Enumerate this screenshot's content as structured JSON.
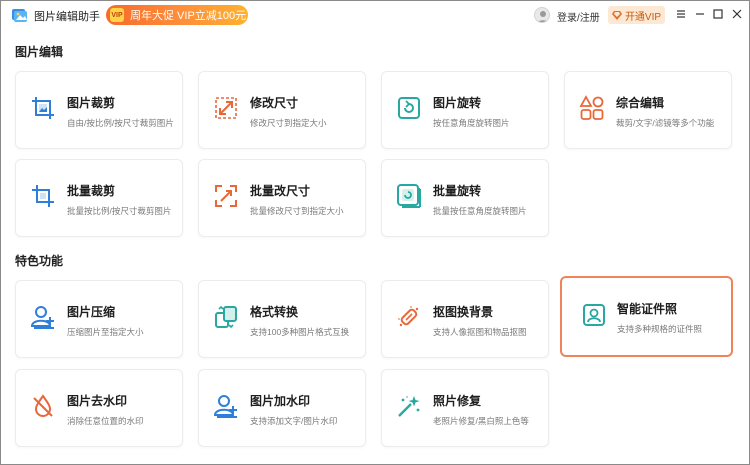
{
  "app": {
    "title": "图片编辑助手",
    "promo_badge": "VIP",
    "promo_text": "周年大促 VIP立减100元",
    "login_text": "登录/注册",
    "vip_button": "开通VIP"
  },
  "colors": {
    "accent_orange": "#e8683a",
    "accent_blue": "#2e7fd9",
    "accent_teal": "#28a8a0",
    "selected_border": "#f0835a"
  },
  "sections": {
    "edit_title": "图片编辑",
    "feature_title": "特色功能"
  },
  "edit_cards": [
    {
      "title": "图片裁剪",
      "desc": "自由/按比例/按尺寸裁剪图片",
      "icon": "crop-image-icon"
    },
    {
      "title": "修改尺寸",
      "desc": "修改尺寸到指定大小",
      "icon": "resize-icon"
    },
    {
      "title": "图片旋转",
      "desc": "按任意角度旋转图片",
      "icon": "rotate-icon"
    },
    {
      "title": "综合编辑",
      "desc": "裁剪/文字/滤镜等多个功能",
      "icon": "shapes-edit-icon"
    },
    {
      "title": "批量裁剪",
      "desc": "批量按比例/按尺寸裁剪图片",
      "icon": "batch-crop-icon"
    },
    {
      "title": "批量改尺寸",
      "desc": "批量修改尺寸到指定大小",
      "icon": "batch-resize-icon"
    },
    {
      "title": "批量旋转",
      "desc": "批量按任意角度旋转图片",
      "icon": "batch-rotate-icon"
    }
  ],
  "feature_cards": [
    {
      "title": "图片压缩",
      "desc": "压缩图片至指定大小",
      "icon": "compress-icon"
    },
    {
      "title": "格式转换",
      "desc": "支持100多种图片格式互换",
      "icon": "format-convert-icon"
    },
    {
      "title": "抠图换背景",
      "desc": "支持人像抠图和物品抠图",
      "icon": "cutout-icon"
    },
    {
      "title": "智能证件照",
      "desc": "支持多种规格的证件照",
      "icon": "id-photo-icon"
    },
    {
      "title": "图片去水印",
      "desc": "消除任意位置的水印",
      "icon": "remove-watermark-icon"
    },
    {
      "title": "图片加水印",
      "desc": "支持添加文字/图片水印",
      "icon": "add-watermark-icon"
    },
    {
      "title": "照片修复",
      "desc": "老照片修复/黑白照上色等",
      "icon": "photo-repair-icon"
    }
  ]
}
